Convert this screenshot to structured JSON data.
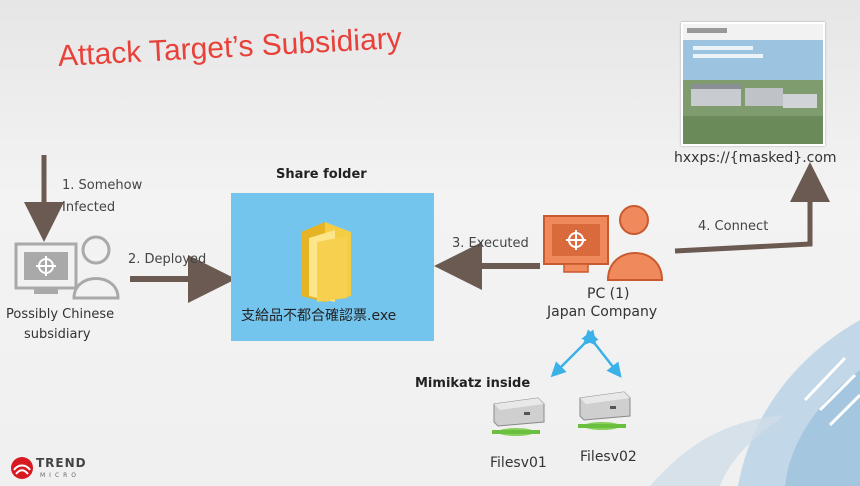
{
  "slide": {
    "title": "Attack Target’s Subsidiary",
    "labels": {
      "somehow_line1": "1. Somehow",
      "somehow_line2": "Infected",
      "deployed": "2. Deployed",
      "executed": "3. Executed",
      "connect": "4. Connect",
      "share_folder": "Share folder",
      "file_name": "支給品不都合確認票.exe",
      "subsidiary_line1": "Possibly Chinese",
      "subsidiary_line2": "subsidiary",
      "pc_line1": "PC (1)",
      "pc_line2": "Japan Company",
      "url": "hxxps://{masked}.com",
      "mimikatz": "Mimikatz inside",
      "filesv01": "Filesv01",
      "filesv02": "Filesv02"
    },
    "logo": {
      "name": "TREND",
      "sub": "MICRO"
    },
    "colors": {
      "title": "#e8413a",
      "arrow": "#6b5a52",
      "share_box": "#74c5ee",
      "pc_orange": "#f08a5d",
      "pc_outline": "#c85a2e",
      "gray_icon": "#a9a9a9",
      "link_blue": "#3ab2e8"
    }
  }
}
